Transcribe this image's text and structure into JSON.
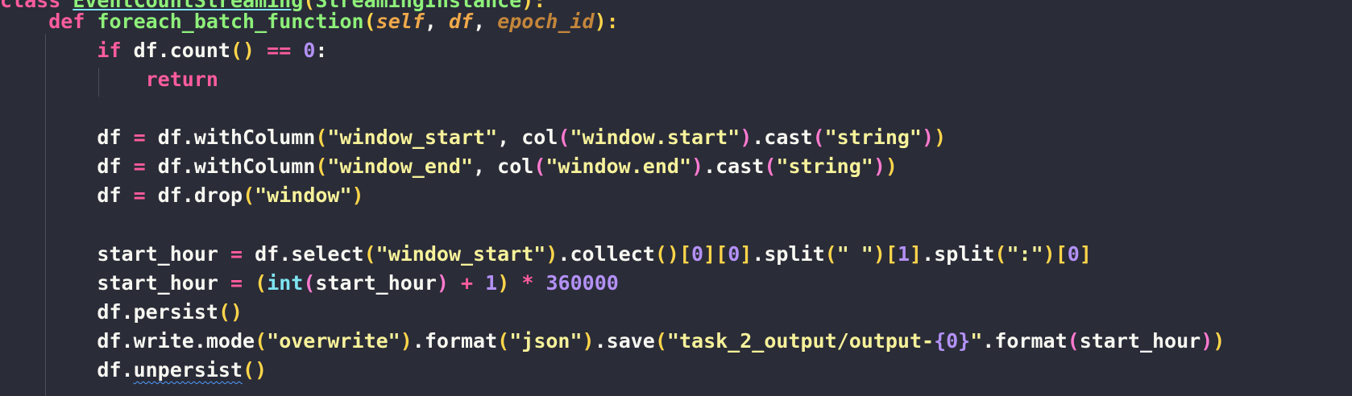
{
  "editor": {
    "lines": [
      {
        "id": "l0",
        "tokens": [
          {
            "t": "class ",
            "c": "kw"
          },
          {
            "t": "EventCountStreaming",
            "c": "fn link-under"
          },
          {
            "t": "(",
            "c": "br1"
          },
          {
            "t": "StreamingInstance",
            "c": "fn"
          },
          {
            "t": "):",
            "c": "br1"
          }
        ]
      },
      {
        "id": "l1",
        "tokens": [
          {
            "t": "    ",
            "c": "plain"
          },
          {
            "t": "def ",
            "c": "kw"
          },
          {
            "t": "foreach_batch_function",
            "c": "fn"
          },
          {
            "t": "(",
            "c": "br1"
          },
          {
            "t": "self",
            "c": "param"
          },
          {
            "t": ", ",
            "c": "plain"
          },
          {
            "t": "df",
            "c": "param"
          },
          {
            "t": ", ",
            "c": "plain"
          },
          {
            "t": "epoch_id",
            "c": "param-dim"
          },
          {
            "t": "):",
            "c": "br1"
          }
        ]
      },
      {
        "id": "l2",
        "tokens": [
          {
            "t": "        ",
            "c": "plain"
          },
          {
            "t": "if ",
            "c": "kw"
          },
          {
            "t": "df.count",
            "c": "plain"
          },
          {
            "t": "()",
            "c": "br1"
          },
          {
            "t": " ",
            "c": "plain"
          },
          {
            "t": "==",
            "c": "op"
          },
          {
            "t": " ",
            "c": "plain"
          },
          {
            "t": "0",
            "c": "num"
          },
          {
            "t": ":",
            "c": "plain"
          }
        ]
      },
      {
        "id": "l3",
        "tokens": [
          {
            "t": "            ",
            "c": "plain"
          },
          {
            "t": "return",
            "c": "kw"
          }
        ]
      },
      {
        "id": "l4",
        "tokens": []
      },
      {
        "id": "l5",
        "tokens": [
          {
            "t": "        ",
            "c": "plain"
          },
          {
            "t": "df ",
            "c": "plain"
          },
          {
            "t": "=",
            "c": "op"
          },
          {
            "t": " df.withColumn",
            "c": "plain"
          },
          {
            "t": "(",
            "c": "br1"
          },
          {
            "t": "\"window_start\"",
            "c": "str"
          },
          {
            "t": ", col",
            "c": "plain"
          },
          {
            "t": "(",
            "c": "br2"
          },
          {
            "t": "\"window.start\"",
            "c": "str"
          },
          {
            "t": ")",
            "c": "br2"
          },
          {
            "t": ".cast",
            "c": "plain"
          },
          {
            "t": "(",
            "c": "br2"
          },
          {
            "t": "\"string\"",
            "c": "str"
          },
          {
            "t": ")",
            "c": "br2"
          },
          {
            "t": ")",
            "c": "br1"
          }
        ]
      },
      {
        "id": "l6",
        "tokens": [
          {
            "t": "        ",
            "c": "plain"
          },
          {
            "t": "df ",
            "c": "plain"
          },
          {
            "t": "=",
            "c": "op"
          },
          {
            "t": " df.withColumn",
            "c": "plain"
          },
          {
            "t": "(",
            "c": "br1"
          },
          {
            "t": "\"window_end\"",
            "c": "str"
          },
          {
            "t": ", col",
            "c": "plain"
          },
          {
            "t": "(",
            "c": "br2"
          },
          {
            "t": "\"window.end\"",
            "c": "str"
          },
          {
            "t": ")",
            "c": "br2"
          },
          {
            "t": ".cast",
            "c": "plain"
          },
          {
            "t": "(",
            "c": "br2"
          },
          {
            "t": "\"string\"",
            "c": "str"
          },
          {
            "t": ")",
            "c": "br2"
          },
          {
            "t": ")",
            "c": "br1"
          }
        ]
      },
      {
        "id": "l7",
        "tokens": [
          {
            "t": "        ",
            "c": "plain"
          },
          {
            "t": "df ",
            "c": "plain"
          },
          {
            "t": "=",
            "c": "op"
          },
          {
            "t": " df.drop",
            "c": "plain"
          },
          {
            "t": "(",
            "c": "br1"
          },
          {
            "t": "\"window\"",
            "c": "str"
          },
          {
            "t": ")",
            "c": "br1"
          }
        ]
      },
      {
        "id": "l8",
        "tokens": []
      },
      {
        "id": "l9",
        "tokens": [
          {
            "t": "        ",
            "c": "plain"
          },
          {
            "t": "start_hour ",
            "c": "plain"
          },
          {
            "t": "=",
            "c": "op"
          },
          {
            "t": " df.select",
            "c": "plain"
          },
          {
            "t": "(",
            "c": "br1"
          },
          {
            "t": "\"window_start\"",
            "c": "str"
          },
          {
            "t": ")",
            "c": "br1"
          },
          {
            "t": ".collect",
            "c": "plain"
          },
          {
            "t": "()",
            "c": "br1"
          },
          {
            "t": "[",
            "c": "br1"
          },
          {
            "t": "0",
            "c": "num"
          },
          {
            "t": "]",
            "c": "br1"
          },
          {
            "t": "[",
            "c": "br1"
          },
          {
            "t": "0",
            "c": "num"
          },
          {
            "t": "]",
            "c": "br1"
          },
          {
            "t": ".split",
            "c": "plain"
          },
          {
            "t": "(",
            "c": "br1"
          },
          {
            "t": "\" \"",
            "c": "str"
          },
          {
            "t": ")",
            "c": "br1"
          },
          {
            "t": "[",
            "c": "br1"
          },
          {
            "t": "1",
            "c": "num"
          },
          {
            "t": "]",
            "c": "br1"
          },
          {
            "t": ".split",
            "c": "plain"
          },
          {
            "t": "(",
            "c": "br1"
          },
          {
            "t": "\":\"",
            "c": "str"
          },
          {
            "t": ")",
            "c": "br1"
          },
          {
            "t": "[",
            "c": "br1"
          },
          {
            "t": "0",
            "c": "num"
          },
          {
            "t": "]",
            "c": "br1"
          }
        ]
      },
      {
        "id": "l10",
        "tokens": [
          {
            "t": "        ",
            "c": "plain"
          },
          {
            "t": "start_hour ",
            "c": "plain"
          },
          {
            "t": "=",
            "c": "op"
          },
          {
            "t": " ",
            "c": "plain"
          },
          {
            "t": "(",
            "c": "br1"
          },
          {
            "t": "int",
            "c": "builtin"
          },
          {
            "t": "(",
            "c": "br2"
          },
          {
            "t": "start_hour",
            "c": "plain"
          },
          {
            "t": ")",
            "c": "br2"
          },
          {
            "t": " ",
            "c": "plain"
          },
          {
            "t": "+",
            "c": "op"
          },
          {
            "t": " ",
            "c": "plain"
          },
          {
            "t": "1",
            "c": "num"
          },
          {
            "t": ")",
            "c": "br1"
          },
          {
            "t": " ",
            "c": "plain"
          },
          {
            "t": "*",
            "c": "op"
          },
          {
            "t": " ",
            "c": "plain"
          },
          {
            "t": "360000",
            "c": "num"
          }
        ]
      },
      {
        "id": "l11",
        "tokens": [
          {
            "t": "        ",
            "c": "plain"
          },
          {
            "t": "df.persist",
            "c": "plain"
          },
          {
            "t": "()",
            "c": "br1"
          }
        ]
      },
      {
        "id": "l12",
        "tokens": [
          {
            "t": "        ",
            "c": "plain"
          },
          {
            "t": "df.write.mode",
            "c": "plain"
          },
          {
            "t": "(",
            "c": "br1"
          },
          {
            "t": "\"overwrite\"",
            "c": "str"
          },
          {
            "t": ")",
            "c": "br1"
          },
          {
            "t": ".format",
            "c": "plain"
          },
          {
            "t": "(",
            "c": "br1"
          },
          {
            "t": "\"json\"",
            "c": "str"
          },
          {
            "t": ")",
            "c": "br1"
          },
          {
            "t": ".save",
            "c": "plain"
          },
          {
            "t": "(",
            "c": "br1"
          },
          {
            "t": "\"task_2_output/output-",
            "c": "str"
          },
          {
            "t": "{0}",
            "c": "fmt"
          },
          {
            "t": "\"",
            "c": "str"
          },
          {
            "t": ".format",
            "c": "plain"
          },
          {
            "t": "(",
            "c": "br2"
          },
          {
            "t": "start_hour",
            "c": "plain"
          },
          {
            "t": ")",
            "c": "br2"
          },
          {
            "t": ")",
            "c": "br1"
          }
        ]
      },
      {
        "id": "l13",
        "tokens": [
          {
            "t": "        ",
            "c": "plain"
          },
          {
            "t": "df.",
            "c": "plain"
          },
          {
            "t": "unpersist",
            "c": "plain squiggle"
          },
          {
            "t": "()",
            "c": "br1"
          }
        ]
      }
    ]
  }
}
